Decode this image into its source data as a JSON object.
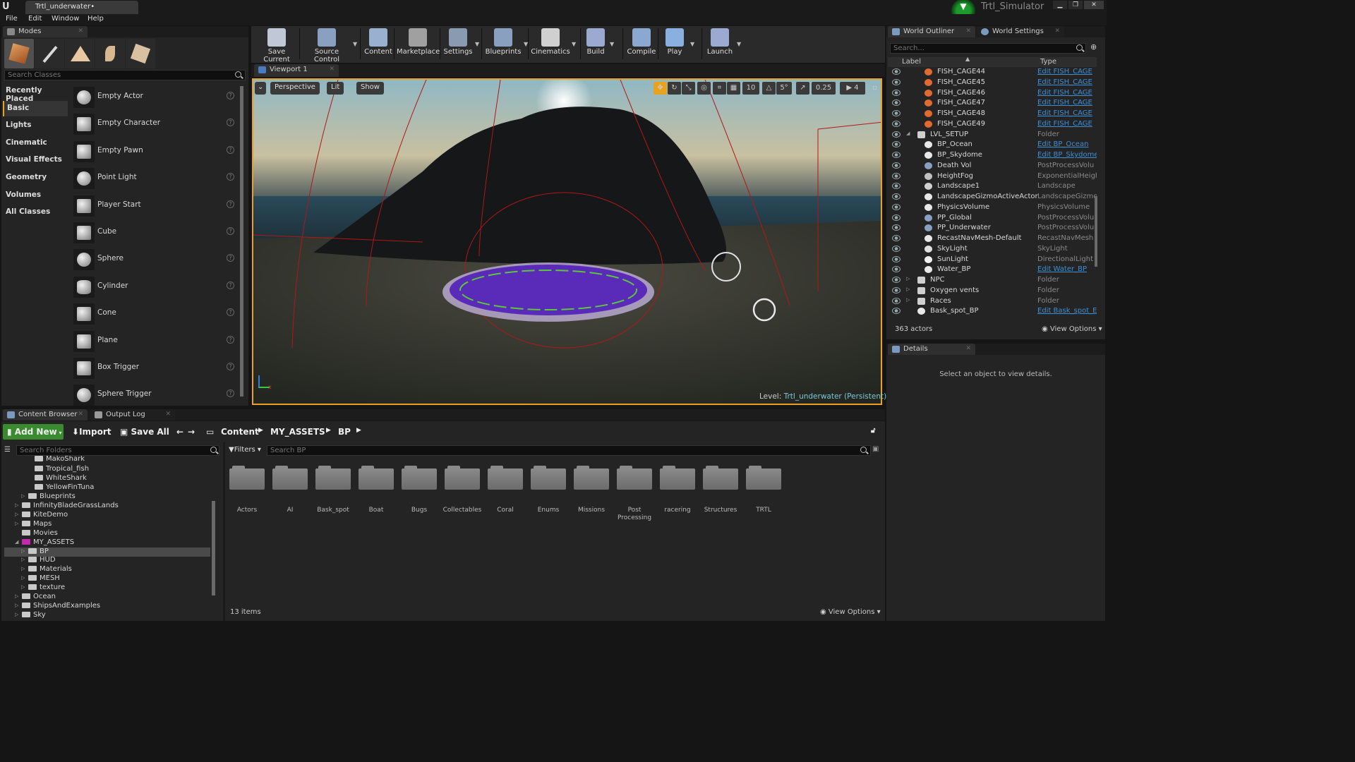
{
  "window": {
    "doc_tab": "Trtl_underwater•",
    "project_name": "Trtl_Simulator"
  },
  "menu": [
    "File",
    "Edit",
    "Window",
    "Help"
  ],
  "modes": {
    "tab": "Modes",
    "search_placeholder": "Search Classes",
    "categories": [
      "Recently Placed",
      "Basic",
      "Lights",
      "Cinematic",
      "Visual Effects",
      "Geometry",
      "Volumes",
      "All Classes"
    ],
    "selected_category": "Basic",
    "items": [
      "Empty Actor",
      "Empty Character",
      "Empty Pawn",
      "Point Light",
      "Player Start",
      "Cube",
      "Sphere",
      "Cylinder",
      "Cone",
      "Plane",
      "Box Trigger",
      "Sphere Trigger"
    ]
  },
  "toolbar": [
    "Save Current",
    "Source Control",
    "Content",
    "Marketplace",
    "Settings",
    "Blueprints",
    "Cinematics",
    "Build",
    "Compile",
    "Play",
    "Launch"
  ],
  "viewport": {
    "tab": "Viewport 1",
    "perspective": "Perspective",
    "lit": "Lit",
    "show": "Show",
    "grid": "10",
    "angle": "5°",
    "scale": "0.25",
    "camera_speed": "4",
    "level_prefix": "Level:",
    "level_name": "Trtl_underwater (Persistent)"
  },
  "outliner": {
    "tab": "World Outliner",
    "tab2": "World Settings",
    "search_placeholder": "Search...",
    "col_label": "Label",
    "col_type": "Type",
    "rows": [
      {
        "label": "FISH_CAGE44",
        "type": "Edit FISH_CAGE",
        "link": true,
        "indent": 2,
        "icon": "actor"
      },
      {
        "label": "FISH_CAGE45",
        "type": "Edit FISH_CAGE",
        "link": true,
        "indent": 2,
        "icon": "actor"
      },
      {
        "label": "FISH_CAGE46",
        "type": "Edit FISH_CAGE",
        "link": true,
        "indent": 2,
        "icon": "actor"
      },
      {
        "label": "FISH_CAGE47",
        "type": "Edit FISH_CAGE",
        "link": true,
        "indent": 2,
        "icon": "actor"
      },
      {
        "label": "FISH_CAGE48",
        "type": "Edit FISH_CAGE",
        "link": true,
        "indent": 2,
        "icon": "actor"
      },
      {
        "label": "FISH_CAGE49",
        "type": "Edit FISH_CAGE",
        "link": true,
        "indent": 2,
        "icon": "actor"
      },
      {
        "label": "LVL_SETUP",
        "type": "Folder",
        "link": false,
        "indent": 1,
        "icon": "folder",
        "arrow": "◢"
      },
      {
        "label": "BP_Ocean",
        "type": "Edit BP_Ocean",
        "link": true,
        "indent": 2,
        "icon": "sphere"
      },
      {
        "label": "BP_Skydome",
        "type": "Edit BP_Skydome",
        "link": true,
        "indent": 2,
        "icon": "sphere"
      },
      {
        "label": "Death Vol",
        "type": "PostProcessVolu",
        "link": false,
        "indent": 2,
        "icon": "volume"
      },
      {
        "label": "HeightFog",
        "type": "ExponentialHeigh",
        "link": false,
        "indent": 2,
        "icon": "fog"
      },
      {
        "label": "Landscape1",
        "type": "Landscape",
        "link": false,
        "indent": 2,
        "icon": "landscape"
      },
      {
        "label": "LandscapeGizmoActiveActor",
        "type": "LandscapeGizmoA",
        "link": false,
        "indent": 2,
        "icon": "sphere"
      },
      {
        "label": "PhysicsVolume",
        "type": "PhysicsVolume",
        "link": false,
        "indent": 2,
        "icon": "sphere"
      },
      {
        "label": "PP_Global",
        "type": "PostProcessVolu",
        "link": false,
        "indent": 2,
        "icon": "volume"
      },
      {
        "label": "PP_Underwater",
        "type": "PostProcessVolu",
        "link": false,
        "indent": 2,
        "icon": "volume"
      },
      {
        "label": "RecastNavMesh-Default",
        "type": "RecastNavMesh",
        "link": false,
        "indent": 2,
        "icon": "sphere"
      },
      {
        "label": "SkyLight",
        "type": "SkyLight",
        "link": false,
        "indent": 2,
        "icon": "light"
      },
      {
        "label": "SunLight",
        "type": "DirectionalLight",
        "link": false,
        "indent": 2,
        "icon": "sun"
      },
      {
        "label": "Water_BP",
        "type": "Edit Water_BP",
        "link": true,
        "indent": 2,
        "icon": "sphere"
      },
      {
        "label": "NPC",
        "type": "Folder",
        "link": false,
        "indent": 1,
        "icon": "folder",
        "arrow": "▷"
      },
      {
        "label": "Oxygen vents",
        "type": "Folder",
        "link": false,
        "indent": 1,
        "icon": "folder",
        "arrow": "▷"
      },
      {
        "label": "Races",
        "type": "Folder",
        "link": false,
        "indent": 1,
        "icon": "folder",
        "arrow": "▷"
      },
      {
        "label": "Bask_spot_BP",
        "type": "Edit Bask_spot_E",
        "link": true,
        "indent": 1,
        "icon": "sphere"
      }
    ],
    "count": "363 actors",
    "view_options": "View Options"
  },
  "details": {
    "tab": "Details",
    "empty": "Select an object to view details."
  },
  "bottom": {
    "tab1": "Content Browser",
    "tab2": "Output Log",
    "add_new": "Add New",
    "import": "Import",
    "save_all": "Save All",
    "path": [
      "Content",
      "MY_ASSETS",
      "BP"
    ],
    "search_folders": "Search Folders",
    "filters": "Filters",
    "search_bp": "Search BP",
    "tree": [
      {
        "name": "MakoShark",
        "indent": 3
      },
      {
        "name": "Tropical_fish",
        "indent": 3
      },
      {
        "name": "WhiteShark",
        "indent": 3
      },
      {
        "name": "YellowFinTuna",
        "indent": 3
      },
      {
        "name": "Blueprints",
        "indent": 2,
        "arrow": "▷"
      },
      {
        "name": "InfinityBladeGrassLands",
        "indent": 1,
        "arrow": "▷"
      },
      {
        "name": "KiteDemo",
        "indent": 1,
        "arrow": "▷"
      },
      {
        "name": "Maps",
        "indent": 1,
        "arrow": "▷"
      },
      {
        "name": "Movies",
        "indent": 1
      },
      {
        "name": "MY_ASSETS",
        "indent": 1,
        "arrow": "◢",
        "magenta": true
      },
      {
        "name": "BP",
        "indent": 2,
        "arrow": "▷",
        "selected": true
      },
      {
        "name": "HUD",
        "indent": 2,
        "arrow": "▷"
      },
      {
        "name": "Materials",
        "indent": 2,
        "arrow": "▷"
      },
      {
        "name": "MESH",
        "indent": 2,
        "arrow": "▷"
      },
      {
        "name": "texture",
        "indent": 2,
        "arrow": "▷"
      },
      {
        "name": "Ocean",
        "indent": 1,
        "arrow": "▷"
      },
      {
        "name": "ShipsAndExamples",
        "indent": 1,
        "arrow": "▷"
      },
      {
        "name": "Sky",
        "indent": 1,
        "arrow": "▷"
      }
    ],
    "folders": [
      "Actors",
      "AI",
      "Bask_spot",
      "Boat",
      "Bugs",
      "Collectables",
      "Coral",
      "Enums",
      "Missions",
      "Post Processing",
      "racering",
      "Structures",
      "TRTL"
    ],
    "items_count": "13 items",
    "view_options": "View Options"
  }
}
